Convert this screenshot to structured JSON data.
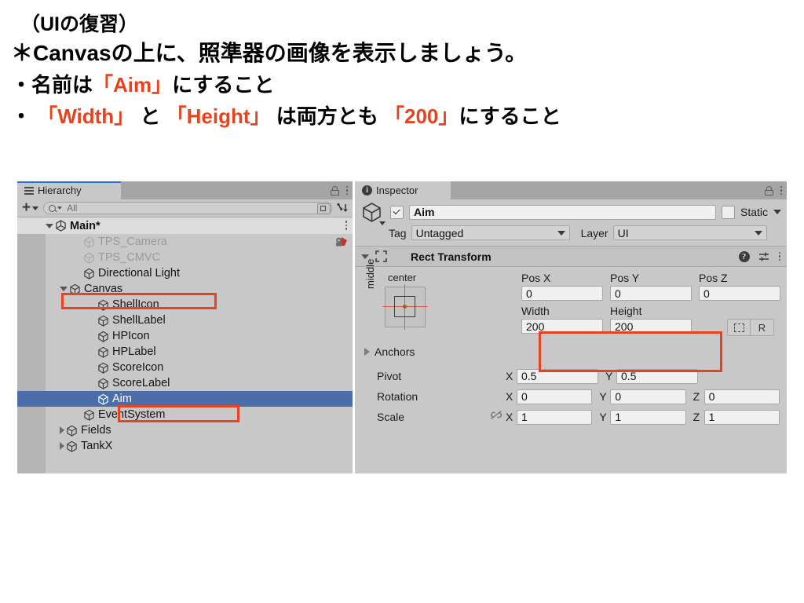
{
  "slide": {
    "line1": "（UIの復習）",
    "line2": "＊Canvasの上に、照準器の画像を表示しましょう。",
    "line3_a": "・名前は",
    "line3_hl": "「Aim」",
    "line3_b": "にすること",
    "line4_a": "・ ",
    "line4_hl1": "「Width」",
    "line4_b": " と ",
    "line4_hl2": "「Height」",
    "line4_c": " は両方とも ",
    "line4_hl3": "「200」",
    "line4_d": "にすること",
    "accent_color": "#e8431f"
  },
  "hierarchy": {
    "tab_label": "Hierarchy",
    "toolbar": {
      "add_label": "+",
      "search_placeholder": "All",
      "search_value": "All"
    },
    "scene": {
      "name": "Main*",
      "expanded": true
    },
    "items": [
      {
        "label": "TPS_Camera",
        "indent": 2,
        "twisty": "none",
        "dim": true,
        "selected": false,
        "has_script_icon": true
      },
      {
        "label": "TPS_CMVC",
        "indent": 2,
        "twisty": "none",
        "dim": true,
        "selected": false,
        "has_script_icon": false
      },
      {
        "label": "Directional Light",
        "indent": 2,
        "twisty": "none",
        "dim": false,
        "selected": false,
        "has_script_icon": false
      },
      {
        "label": "Canvas",
        "indent": 1,
        "twisty": "open",
        "dim": false,
        "selected": false,
        "has_script_icon": false
      },
      {
        "label": "ShellIcon",
        "indent": 3,
        "twisty": "none",
        "dim": false,
        "selected": false,
        "has_script_icon": false
      },
      {
        "label": "ShellLabel",
        "indent": 3,
        "twisty": "none",
        "dim": false,
        "selected": false,
        "has_script_icon": false
      },
      {
        "label": "HPIcon",
        "indent": 3,
        "twisty": "none",
        "dim": false,
        "selected": false,
        "has_script_icon": false
      },
      {
        "label": "HPLabel",
        "indent": 3,
        "twisty": "none",
        "dim": false,
        "selected": false,
        "has_script_icon": false
      },
      {
        "label": "ScoreIcon",
        "indent": 3,
        "twisty": "none",
        "dim": false,
        "selected": false,
        "has_script_icon": false
      },
      {
        "label": "ScoreLabel",
        "indent": 3,
        "twisty": "none",
        "dim": false,
        "selected": false,
        "has_script_icon": false
      },
      {
        "label": "Aim",
        "indent": 3,
        "twisty": "none",
        "dim": false,
        "selected": true,
        "has_script_icon": false
      },
      {
        "label": "EventSystem",
        "indent": 2,
        "twisty": "none",
        "dim": false,
        "selected": false,
        "has_script_icon": false
      },
      {
        "label": "Fields",
        "indent": 1,
        "twisty": "closed",
        "dim": false,
        "selected": false,
        "has_script_icon": false
      },
      {
        "label": "TankX",
        "indent": 1,
        "twisty": "closed",
        "dim": false,
        "selected": false,
        "has_script_icon": false
      }
    ]
  },
  "inspector": {
    "tab_label": "Inspector",
    "object": {
      "enabled": true,
      "name": "Aim",
      "static_label": "Static",
      "static_checked": false,
      "tag_label": "Tag",
      "tag_value": "Untagged",
      "layer_label": "Layer",
      "layer_value": "UI"
    },
    "rect_transform": {
      "title": "Rect Transform",
      "expanded": true,
      "anchor_preset": {
        "horizontal": "center",
        "vertical": "middle"
      },
      "fields": {
        "pos_x_label": "Pos X",
        "pos_x": "0",
        "pos_y_label": "Pos Y",
        "pos_y": "0",
        "pos_z_label": "Pos Z",
        "pos_z": "0",
        "width_label": "Width",
        "width": "200",
        "height_label": "Height",
        "height": "200"
      },
      "blueprint_label": "",
      "raw_label": "R",
      "anchors_label": "Anchors",
      "pivot_label": "Pivot",
      "pivot_x": "0.5",
      "pivot_y": "0.5",
      "rotation_label": "Rotation",
      "rotation_x": "0",
      "rotation_y": "0",
      "rotation_z": "0",
      "scale_label": "Scale",
      "scale_x": "1",
      "scale_y": "1",
      "scale_z": "1",
      "axis_x": "X",
      "axis_y": "Y",
      "axis_z": "Z"
    }
  }
}
